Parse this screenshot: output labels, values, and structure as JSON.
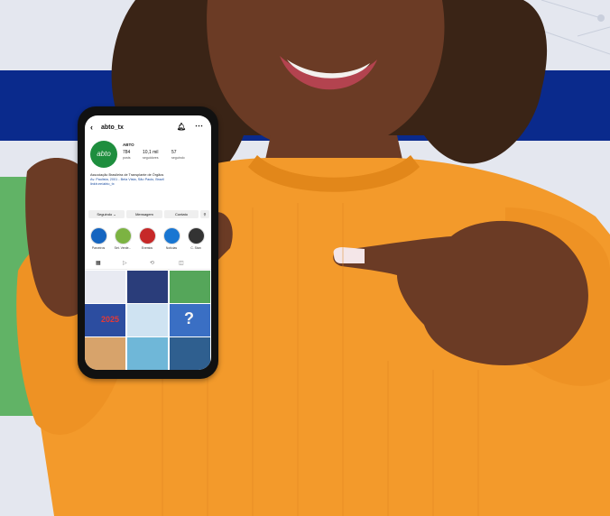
{
  "profile": {
    "username": "abto_tx",
    "avatar_text": "abto",
    "account_name": "ABTO",
    "stats": [
      {
        "value": "784",
        "label": "posts"
      },
      {
        "value": "10,1 mil",
        "label": "seguidores"
      },
      {
        "value": "57",
        "label": "seguindo"
      }
    ],
    "bio": "Associação Brasileira de Transplante de Órgãos",
    "address": "Av. Paulista, 2001 - Bela Vista, São Paulo, Brazil",
    "link": "linktr.ee/abto_tx"
  },
  "buttons": {
    "following": "Seguindo ⌄",
    "message": "Mensagem",
    "contact": "Contato"
  },
  "highlights": [
    {
      "label": "Parceiros",
      "color": "#1565c0"
    },
    {
      "label": "Set. Verde...",
      "color": "#7cb342"
    },
    {
      "label": "Eventos",
      "color": "#c62828"
    },
    {
      "label": "Notícias",
      "color": "#1976d2"
    },
    {
      "label": "C. Stan",
      "color": "#333333"
    }
  ],
  "tabs": {
    "grid_icon": "grid-icon",
    "reels_icon": "reels-icon",
    "repost_icon": "repost-icon",
    "tagged_icon": "tagged-icon"
  },
  "grid_tiles": [
    {
      "color": "#e8eaf2"
    },
    {
      "color": "#2a3d7a"
    },
    {
      "color": "#55a65a"
    },
    {
      "color": "#2c4da0"
    },
    {
      "color": "#cfe3f2"
    },
    {
      "color": "#3a6fc4"
    },
    {
      "color": "#d7a36b"
    },
    {
      "color": "#6fb7d8"
    },
    {
      "color": "#2f5f8f"
    }
  ],
  "tile_text": {
    "year": "2025",
    "question": "?"
  },
  "colors": {
    "navy_band": "#0a2a8c",
    "green_band": "#61b366",
    "sweater": "#f39a2b",
    "background": "#e4e7ef"
  }
}
